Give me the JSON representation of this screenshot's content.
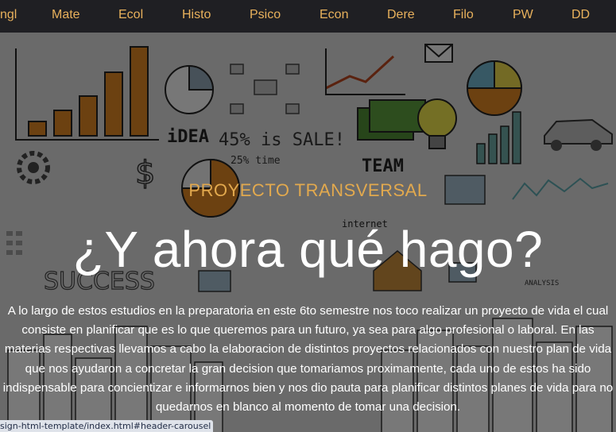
{
  "nav": {
    "items": [
      {
        "label": "ngl"
      },
      {
        "label": "Mate"
      },
      {
        "label": "Ecol"
      },
      {
        "label": "Histo"
      },
      {
        "label": "Psico"
      },
      {
        "label": "Econ"
      },
      {
        "label": "Dere"
      },
      {
        "label": "Filo"
      },
      {
        "label": "PW"
      },
      {
        "label": "DD"
      }
    ]
  },
  "hero": {
    "kicker": "PROYECTO TRANSVERSAL",
    "headline": "¿Y ahora qué hago?",
    "description": "A lo largo de estos estudios en la preparatoria en este 6to semestre nos toco realizar un proyecto de vida el cual consiste en planificar que es lo que queremos para un futuro, ya sea para algo profesional o laboral. En las materias respectivas llevamos a cabo la elaboracion de distintos proyectos relacionados con nuestro plan de vida que nos ayudaron a concretar la gran decision que tomariamos proximamente, cada uno de estos ha sido indispensable para concientizar e informarnos bien y nos dio pauta para planificar distintos planes de vida para no quedarnos en blanco al momento de tomar una decision.",
    "background_doodles": [
      "iDEA",
      "45% is SALE!",
      "25% time",
      "TEAM",
      "internet",
      "SUCCESS",
      "ANALYSIS"
    ]
  },
  "status_bar": {
    "url": "sign-html-template/index.html#header-carousel"
  },
  "colors": {
    "nav_bg": "#1f1f23",
    "nav_text": "#e8b15c",
    "kicker": "#e2a94e",
    "headline": "#ffffff"
  }
}
